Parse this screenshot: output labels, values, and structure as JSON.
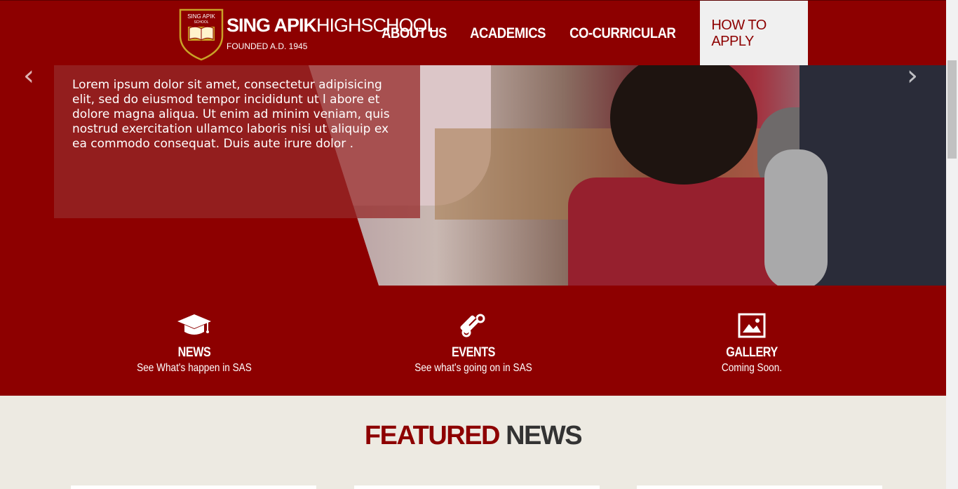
{
  "brand": {
    "crest_top": "SING APIK",
    "crest_small": "SCHOOL",
    "name_bold": "SING APIK",
    "name_light": "HIGHSCHOOL",
    "founded": "FOUNDED A.D. 1945"
  },
  "nav": {
    "items": [
      {
        "label": "ABOUT US"
      },
      {
        "label": "ACADEMICS"
      },
      {
        "label": "CO-CURRICULAR"
      },
      {
        "label": "HOW TO APPLY",
        "active": true
      }
    ]
  },
  "hero": {
    "caption": "Lorem ipsum dolor sit amet, consectetur adipisicing elit, sed do eiusmod tempor incididunt ut l abore et dolore magna aliqua. Ut enim ad minim veniam, quis nostrud exercitation ullamco laboris nisi ut aliquip ex ea commodo consequat. Duis aute irure dolor .",
    "prev": "‹",
    "next": "›"
  },
  "features": [
    {
      "icon": "graduation-cap-icon",
      "title": "NEWS",
      "subtitle": "See What's happen in SAS"
    },
    {
      "icon": "diploma-scroll-icon",
      "title": "EVENTS",
      "subtitle": "See what's going on in SAS"
    },
    {
      "icon": "picture-icon",
      "title": "GALLERY",
      "subtitle": "Coming Soon."
    }
  ],
  "featured": {
    "title_accent": "FEATURED",
    "title_rest": "NEWS"
  },
  "colors": {
    "brand_red": "#8d0000",
    "cream": "#edeae2",
    "gold": "#c9a227"
  }
}
